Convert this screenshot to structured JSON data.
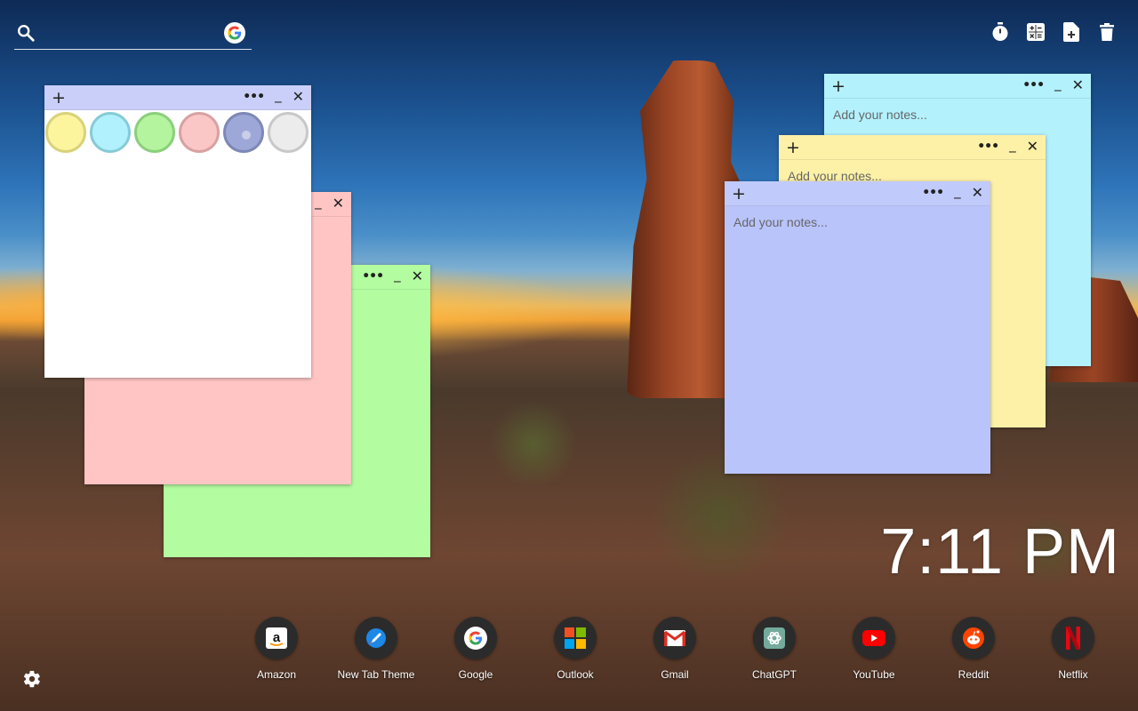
{
  "search": {
    "placeholder": "",
    "icon": "search-icon",
    "engine_icon": "google-icon"
  },
  "toolbar": {
    "icons": [
      "timer-icon",
      "calculator-icon",
      "new-note-icon",
      "trash-icon"
    ]
  },
  "notes": {
    "placeholder": "Add your notes...",
    "white_note": {
      "color": "#ffffff"
    },
    "pink_note": {
      "color": "#ffc5c5"
    },
    "green_note": {
      "color": "#b3fca0"
    },
    "cyan_note": {
      "color": "#b3f1fd"
    },
    "yellow_note": {
      "color": "#fdf1a7"
    },
    "blue_note": {
      "color": "#b9c4fb"
    }
  },
  "palette": {
    "swatches": [
      {
        "name": "yellow",
        "color": "#fdf49e",
        "border": "#d8d27a"
      },
      {
        "name": "cyan",
        "color": "#b1f1fe",
        "border": "#86cbd6"
      },
      {
        "name": "green",
        "color": "#b4f49e",
        "border": "#8ccf7b"
      },
      {
        "name": "pink",
        "color": "#fbc6c6",
        "border": "#d8a2a2"
      },
      {
        "name": "blue",
        "color": "#9ea8d8",
        "border": "#7e88b6",
        "active": true
      },
      {
        "name": "gray",
        "color": "#ececec",
        "border": "#c8c8c8"
      }
    ]
  },
  "clock": {
    "time": "7:11 PM"
  },
  "shortcuts": [
    {
      "label": "Amazon",
      "icon": "amazon-icon"
    },
    {
      "label": "New Tab Theme",
      "icon": "new-tab-theme-icon"
    },
    {
      "label": "Google",
      "icon": "google-icon"
    },
    {
      "label": "Outlook",
      "icon": "outlook-icon"
    },
    {
      "label": "Gmail",
      "icon": "gmail-icon"
    },
    {
      "label": "ChatGPT",
      "icon": "chatgpt-icon"
    },
    {
      "label": "YouTube",
      "icon": "youtube-icon"
    },
    {
      "label": "Reddit",
      "icon": "reddit-icon"
    },
    {
      "label": "Netflix",
      "icon": "netflix-icon"
    }
  ],
  "settings": {
    "icon": "gear-icon"
  }
}
